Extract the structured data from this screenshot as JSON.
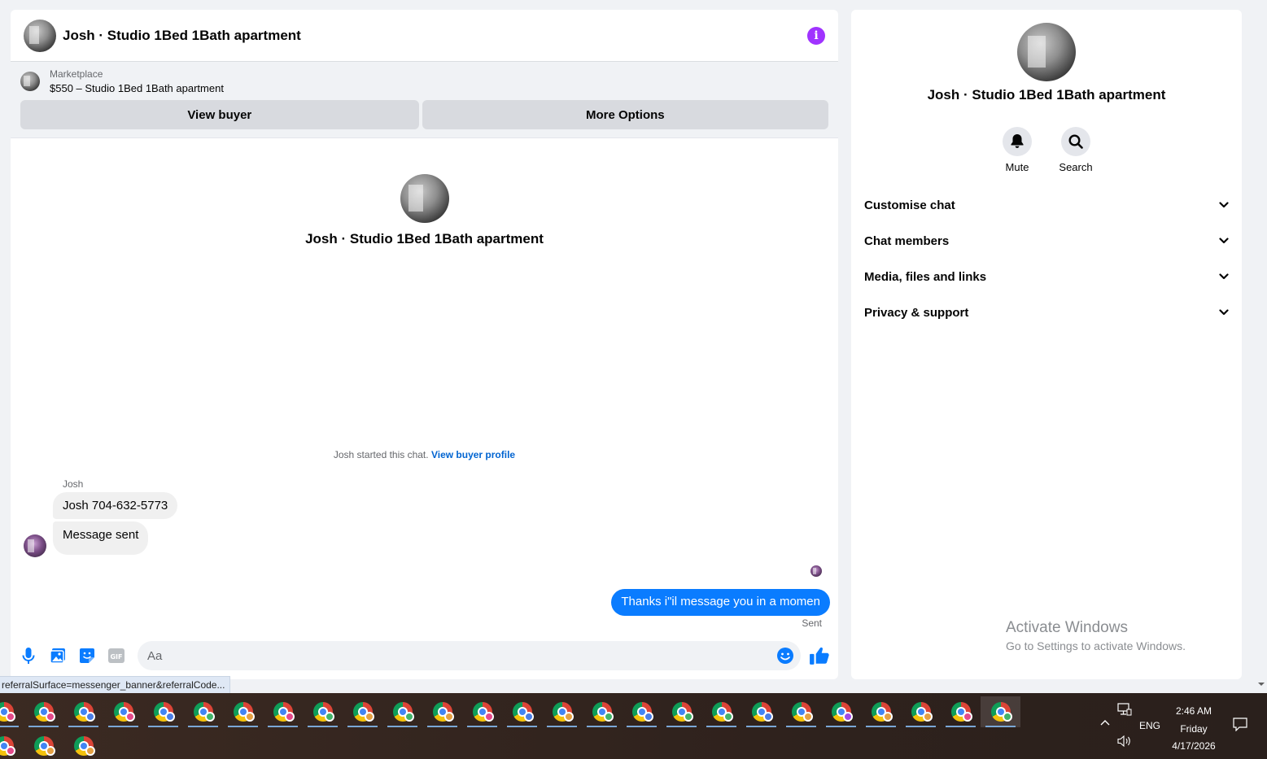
{
  "chat": {
    "title": "Josh · Studio 1Bed 1Bath apartment",
    "info_icon_glyph": "i",
    "marketplace_label": "Marketplace",
    "listing": "$550 – Studio 1Bed 1Bath apartment",
    "view_buyer_label": "View buyer",
    "more_options_label": "More Options",
    "intro_name": "Josh · Studio 1Bed 1Bath apartment",
    "started_text": "Josh started this chat.",
    "view_buyer_profile_label": "View buyer profile",
    "sender_name": "Josh",
    "messages_in": [
      "Josh 704-632-5773",
      "Message sent"
    ],
    "message_out": "Thanks i\"il message you in a momen",
    "sent_status": "Sent",
    "composer_placeholder": "Aa",
    "gif_label": "GIF"
  },
  "info_panel": {
    "name": "Josh · Studio 1Bed 1Bath apartment",
    "actions": [
      {
        "label": "Mute",
        "icon": "bell-icon"
      },
      {
        "label": "Search",
        "icon": "search-icon"
      }
    ],
    "sections": [
      "Customise chat",
      "Chat members",
      "Media, files and links",
      "Privacy & support"
    ],
    "watermark_title": "Activate Windows",
    "watermark_sub": "Go to Settings to activate Windows."
  },
  "status_url": "referralSurface=messenger_banner&referralCode...",
  "taskbar": {
    "row1_badges": [
      "#e54a8a",
      "#e54a8a",
      "#4a7de5",
      "#e54a8a",
      "#4a7de5",
      "#43b36a",
      "#e5a043",
      "#e54a8a",
      "#43b36a",
      "#e5a043",
      "#43b36a",
      "#e5a043",
      "#e54a8a",
      "#4a7de5",
      "#e5a043",
      "#43b36a",
      "#4a7de5",
      "#43b36a",
      "#43b36a",
      "#4a7de5",
      "#e5a043",
      "#a04ae5",
      "#e5a043",
      "#e5a043",
      "#e54a8a",
      "#43b36a"
    ],
    "row2_badges": [
      "#e54a8a",
      "#e5a043",
      "#e5a043"
    ],
    "active_index": 25,
    "language": "ENG",
    "time": "2:46 AM",
    "day": "Friday",
    "date": "4/17/2026"
  },
  "colors": {
    "accent": "#0a7cff",
    "info": "#a033ff",
    "link": "#0064d1"
  }
}
